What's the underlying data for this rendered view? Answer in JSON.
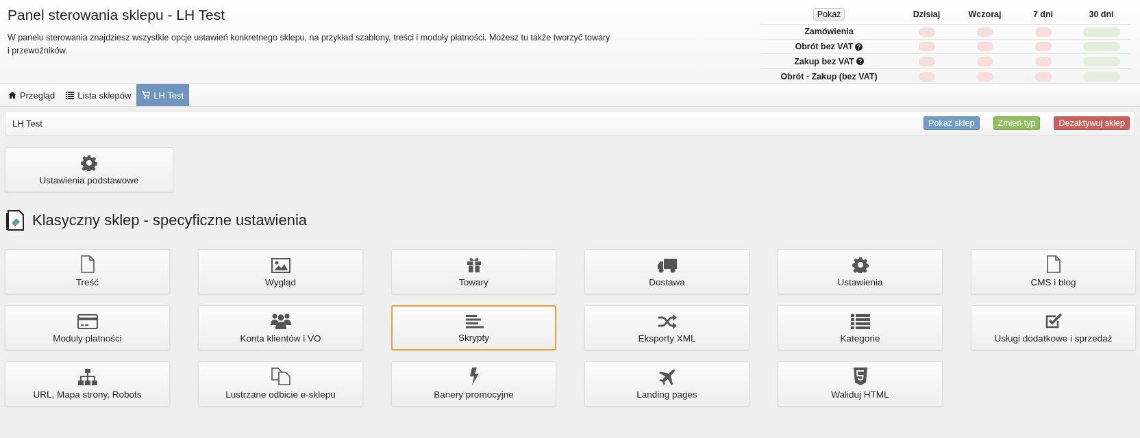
{
  "header": {
    "title": "Panel sterowania sklepu - LH Test",
    "description": "W panelu sterowania znajdziesz wszystkie opcje ustawień konkretnego sklepu, na przykład szablony, treści i moduły płatności. Możesz tu także tworzyć towary i przewoźników."
  },
  "stats": {
    "button": "Pokaż",
    "columns": [
      "Dzisiaj",
      "Wczoraj",
      "7 dni",
      "30 dni"
    ],
    "rows": [
      {
        "label": "Zamówienia",
        "help": false,
        "cells": [
          {
            "color": "#f6dede"
          },
          {
            "color": "#f6dede"
          },
          {
            "color": "#f6dede"
          },
          {
            "color": "#e4eedc"
          }
        ]
      },
      {
        "label": "Obrót bez VAT",
        "help": true,
        "cells": [
          {
            "color": "#f6dede"
          },
          {
            "color": "#f6dede"
          },
          {
            "color": "#f6dede"
          },
          {
            "color": "#e4eedc"
          }
        ]
      },
      {
        "label": "Zakup bez VAT",
        "help": true,
        "cells": [
          {
            "color": "#f6dede"
          },
          {
            "color": "#f6dede"
          },
          {
            "color": "#f6dede"
          },
          {
            "color": "#e4eedc"
          }
        ]
      },
      {
        "label": "Obrót - Zakup (bez VAT)",
        "help": false,
        "cells": [
          {
            "color": "#f6dede"
          },
          {
            "color": "#f6dede"
          },
          {
            "color": "#f6dede"
          },
          {
            "color": "#e4eedc"
          }
        ]
      }
    ]
  },
  "tabs": [
    {
      "label": "Przegląd",
      "selected": false
    },
    {
      "label": "Lista sklepów",
      "selected": false
    },
    {
      "label": "LH Test",
      "selected": true
    }
  ],
  "shop_bar": {
    "name": "LH Test",
    "buttons": [
      {
        "label": "Pokaż sklep",
        "kind": "info"
      },
      {
        "label": "Zmień typ",
        "kind": "success"
      },
      {
        "label": "Dezaktywuj sklep",
        "kind": "danger"
      }
    ]
  },
  "basic_tile": {
    "label": "Ustawienia podstawowe"
  },
  "section": {
    "title": "Klasyczny sklep - specyficzne ustawienia"
  },
  "tiles": [
    {
      "label": "Treść",
      "selected": false
    },
    {
      "label": "Wygląd",
      "selected": false
    },
    {
      "label": "Towary",
      "selected": false
    },
    {
      "label": "Dostawa",
      "selected": false
    },
    {
      "label": "Ustawienia",
      "selected": false
    },
    {
      "label": "CMS i blog",
      "selected": false
    },
    {
      "label": "Moduly platności",
      "selected": false
    },
    {
      "label": "Konta klientów i VO",
      "selected": false
    },
    {
      "label": "Skrypty",
      "selected": true
    },
    {
      "label": "Eksporty XML",
      "selected": false
    },
    {
      "label": "Kategorie",
      "selected": false
    },
    {
      "label": "Usługi dodatkowe i sprzedaż",
      "selected": false
    },
    {
      "label": "URL, Mapa strony, Robots",
      "selected": false
    },
    {
      "label": "Lustrzane odbicie e-sklepu",
      "selected": false
    },
    {
      "label": "Banery promocyjne",
      "selected": false
    },
    {
      "label": "Landing pages",
      "selected": false
    },
    {
      "label": "Waliduj HTML",
      "selected": false
    }
  ]
}
